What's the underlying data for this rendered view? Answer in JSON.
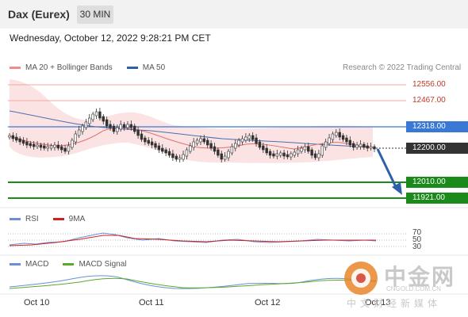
{
  "header": {
    "instrument": "Dax (Eurex)",
    "timeframe": "30 MIN"
  },
  "datetime": "Wednesday, October 12, 2022 9:28:21 PM CET",
  "legend_main": [
    {
      "label": "MA 20 + Bollinger Bands",
      "color": "#f28b8b"
    },
    {
      "label": "MA 50",
      "color": "#2e5fa8"
    }
  ],
  "research": "Research © 2022 Trading Central",
  "levels": [
    {
      "value": "12556.00",
      "type": "resistance",
      "color": "#f0a8a0"
    },
    {
      "value": "12467.00",
      "type": "resistance",
      "color": "#f0a8a0"
    },
    {
      "value": "12318.00",
      "type": "pivot",
      "color": "#3a78d8"
    },
    {
      "value": "12200.00",
      "type": "last",
      "color": "#333333"
    },
    {
      "value": "12010.00",
      "type": "support",
      "color": "#1a8a1a"
    },
    {
      "value": "11921.00",
      "type": "support",
      "color": "#1a8a1a"
    }
  ],
  "rsi_panel": {
    "legend": [
      {
        "label": "RSI",
        "color": "#6a8fd8"
      },
      {
        "label": "9MA",
        "color": "#cc2222"
      }
    ],
    "levels": [
      "70",
      "50",
      "30"
    ]
  },
  "macd_panel": {
    "legend": [
      {
        "label": "MACD",
        "color": "#6a8fd8"
      },
      {
        "label": "MACD Signal",
        "color": "#5aaa2a"
      }
    ]
  },
  "x_axis": [
    "Oct 10",
    "Oct 11",
    "Oct 12",
    "Oct 13"
  ],
  "watermark": {
    "brand": "中金网",
    "site": "CNGOLD.COM.CN",
    "tagline": "中文财经新媒体"
  },
  "icons": {
    "arrow": "down-arrow-icon"
  }
}
